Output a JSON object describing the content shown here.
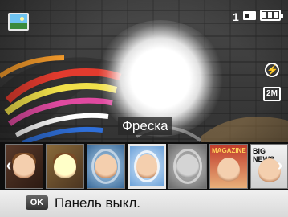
{
  "status_bar": {
    "mode_icon": "landscape-photo-icon",
    "shots_remaining": "1",
    "memory_icon": "memory-card-icon",
    "battery_icon": "battery-full-icon"
  },
  "side_icons": {
    "flash_icon": "flash-auto-icon",
    "flash_glyph": "⚡",
    "size_icon": "resolution-2m-icon",
    "size_label": "2M"
  },
  "effect": {
    "current_label": "Фреска"
  },
  "effect_strip": {
    "left_arrow": "‹",
    "right_arrow": "›",
    "thumbs": [
      {
        "name": "thumb-old-frame",
        "label": ""
      },
      {
        "name": "thumb-sepia",
        "label": ""
      },
      {
        "name": "thumb-fisheye",
        "label": ""
      },
      {
        "name": "thumb-soft",
        "label": ""
      },
      {
        "name": "thumb-bw",
        "label": ""
      },
      {
        "name": "thumb-magazine",
        "label": "MAGAZINE"
      },
      {
        "name": "thumb-big-news",
        "label": "BIG NEWS"
      }
    ]
  },
  "bottom_bar": {
    "key_label": "OK",
    "hint": "Панель выкл."
  },
  "colors": {
    "bar_background": "#e6e6e6",
    "text_dark": "#111111"
  }
}
